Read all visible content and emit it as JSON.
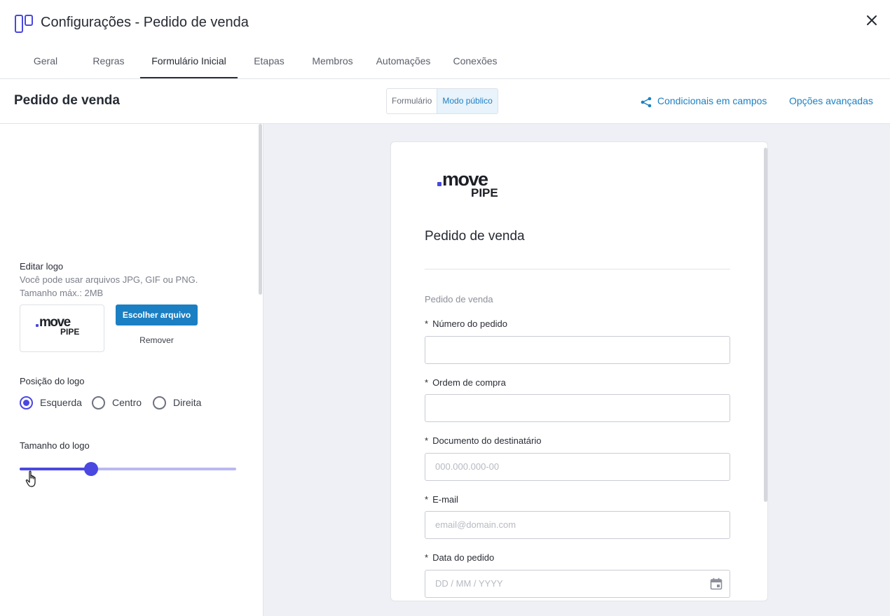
{
  "window": {
    "title": "Configurações - Pedido de venda"
  },
  "tabs": [
    {
      "label": "Geral"
    },
    {
      "label": "Regras"
    },
    {
      "label": "Formulário Inicial",
      "active": true
    },
    {
      "label": "Etapas"
    },
    {
      "label": "Membros"
    },
    {
      "label": "Automações"
    },
    {
      "label": "Conexões"
    }
  ],
  "subheader": {
    "title": "Pedido de venda",
    "toggle": [
      {
        "label": "Formulário"
      },
      {
        "label": "Modo público",
        "active": true
      }
    ],
    "conditional_link": "Condicionais em campos",
    "advanced_link": "Opções avançadas"
  },
  "logo_editor": {
    "title": "Editar logo",
    "hint_formats": "Você pode usar arquivos JPG, GIF ou PNG.",
    "hint_size": "Tamanho máx.: 2MB",
    "choose_button": "Escolher arquivo",
    "remove_button": "Remover",
    "position_title": "Posição do logo",
    "position_options": [
      {
        "label": "Esquerda",
        "checked": true
      },
      {
        "label": "Centro",
        "checked": false
      },
      {
        "label": "Direita",
        "checked": false
      }
    ],
    "size_title": "Tamanho do logo",
    "size_value": 0.33
  },
  "logo": {
    "word1": "move",
    "word2": "PIPE",
    "dot_color": "#4a48e0"
  },
  "form": {
    "title": "Pedido de venda",
    "section": "Pedido de venda",
    "fields": [
      {
        "required": "*",
        "label": "Número do pedido",
        "placeholder": ""
      },
      {
        "required": "*",
        "label": "Ordem de compra",
        "placeholder": ""
      },
      {
        "required": "*",
        "label": "Documento do destinatário",
        "placeholder": "000.000.000-00"
      },
      {
        "required": "*",
        "label": "E-mail",
        "placeholder": "email@domain.com"
      },
      {
        "required": "*",
        "label": "Data do pedido",
        "placeholder": "DD / MM / YYYY",
        "icon": "calendar-icon"
      }
    ]
  },
  "colors": {
    "accent": "#4a48e0",
    "link": "#1b7fc3",
    "preview_bg": "#eef0f5"
  }
}
